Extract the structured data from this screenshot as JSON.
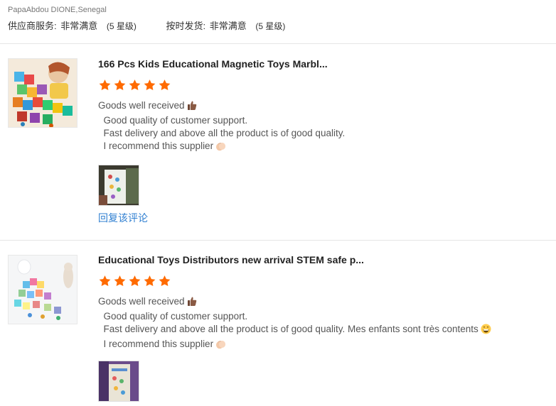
{
  "reviewer": "PapaAbdou DIONE,Senegal",
  "supplier_ratings": [
    {
      "label": "供应商服务:",
      "value": "非常满意",
      "level": "(5 星级)"
    },
    {
      "label": "按时发货:",
      "value": "非常满意",
      "level": "(5 星级)"
    }
  ],
  "reviews": [
    {
      "product_title": "166 Pcs Kids Educational Magnetic Toys Marbl...",
      "rating": 5,
      "lines": [
        "Goods well received",
        "  Good quality of customer support.",
        "  Fast delivery and above all the product is of good quality.",
        "  I recommend this supplier"
      ],
      "reply_label": "回复该评论"
    },
    {
      "product_title": "Educational Toys Distributors new arrival STEM safe p...",
      "rating": 5,
      "lines": [
        "Goods well received",
        "  Good quality of customer support.",
        "  Fast delivery and above all the product is of good quality. Mes enfants sont très contents",
        "  I recommend this supplier"
      ]
    }
  ],
  "colors": {
    "star": "#ff6a00",
    "link": "#2f7fd1"
  },
  "icons": {
    "first_line": "thumbs-up-icon",
    "third_line_r2": "grinning-face-icon",
    "last_line": "clapping-hands-icon"
  }
}
